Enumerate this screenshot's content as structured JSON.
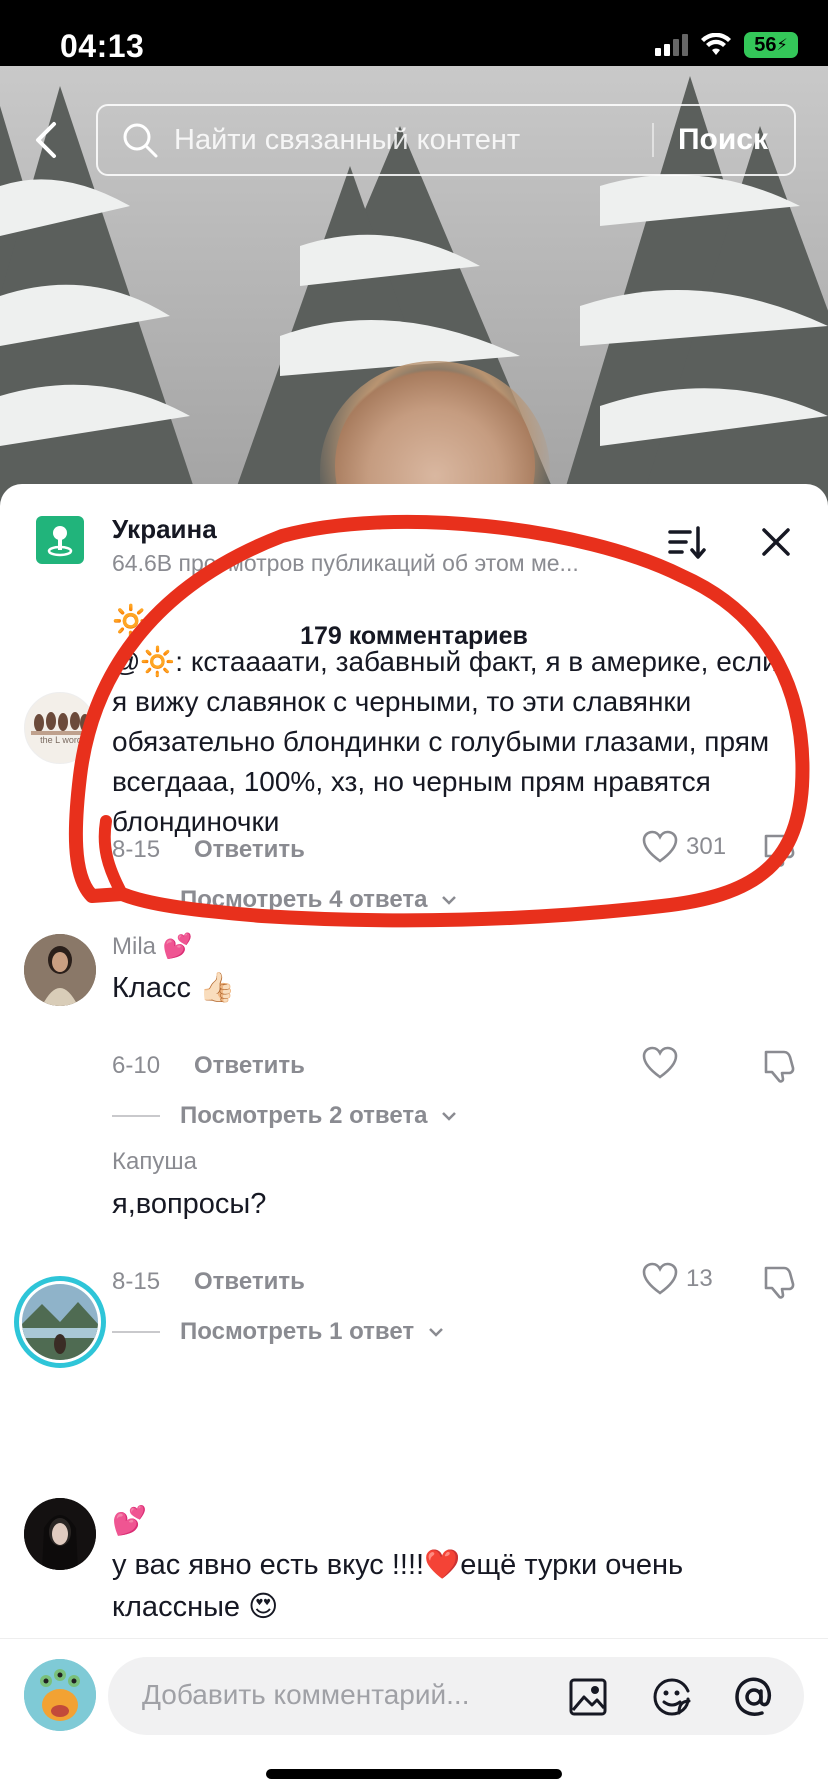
{
  "status": {
    "time": "04:13",
    "battery": "56"
  },
  "search": {
    "placeholder": "Найти связанный контент",
    "button": "Поиск"
  },
  "header": {
    "title": "Украина",
    "subtitle": "64.6B просмотров публикаций об этом ме..."
  },
  "comments_count": "179 комментариев",
  "comments": [
    {
      "author": "🔆",
      "text": "@🔆: кстаааати, забавный факт, я в америке, если я вижу славянок с черными, то эти славянки обязательно блондинки с голубыми глазами, прям всегдааа, 100%, хз, но черным прям нравятся блондиночки",
      "date": "8-15",
      "reply": "Ответить",
      "likes": "301",
      "view_replies": "Посмотреть 4 ответа"
    },
    {
      "author": "Mila 💕",
      "text": "Класс 👍🏻",
      "date": "6-10",
      "reply": "Ответить",
      "likes": "",
      "view_replies": "Посмотреть 2 ответа"
    },
    {
      "author": "Капуша",
      "text": "я,вопросы?",
      "date": "8-15",
      "reply": "Ответить",
      "likes": "13",
      "view_replies": "Посмотреть 1 ответ"
    },
    {
      "author": "💕",
      "text": "у вас явно есть вкус !!!!❤️ещё турки очень классные 😍"
    }
  ],
  "composer": {
    "placeholder": "Добавить комментарий..."
  },
  "avatar_text": {
    "first_comment": "the L word"
  },
  "colors": {
    "accent_red": "#e8301c",
    "location_green": "#21b47b",
    "text_gray": "#8a8b91"
  }
}
